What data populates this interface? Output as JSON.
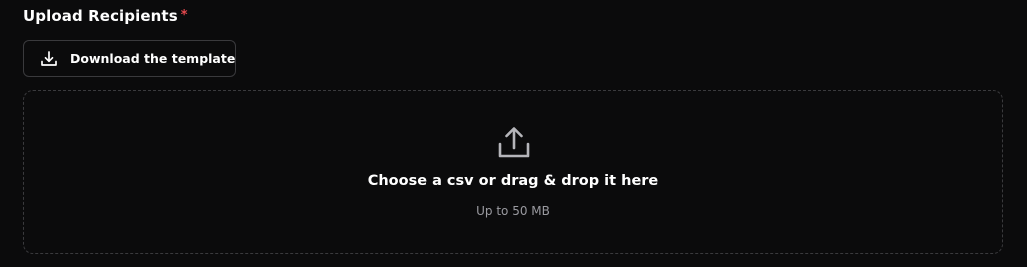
{
  "field": {
    "label": "Upload Recipients",
    "required_marker": "*"
  },
  "download_button": {
    "label": "Download the template",
    "icon": "download-icon"
  },
  "dropzone": {
    "icon": "upload-icon",
    "title": "Choose a csv or drag & drop it here",
    "subtitle": "Up to 50 MB"
  },
  "colors": {
    "background": "#0b0b0c",
    "border": "#3a3a3d",
    "required": "#e5484d",
    "muted_text": "#9a9aa0"
  }
}
